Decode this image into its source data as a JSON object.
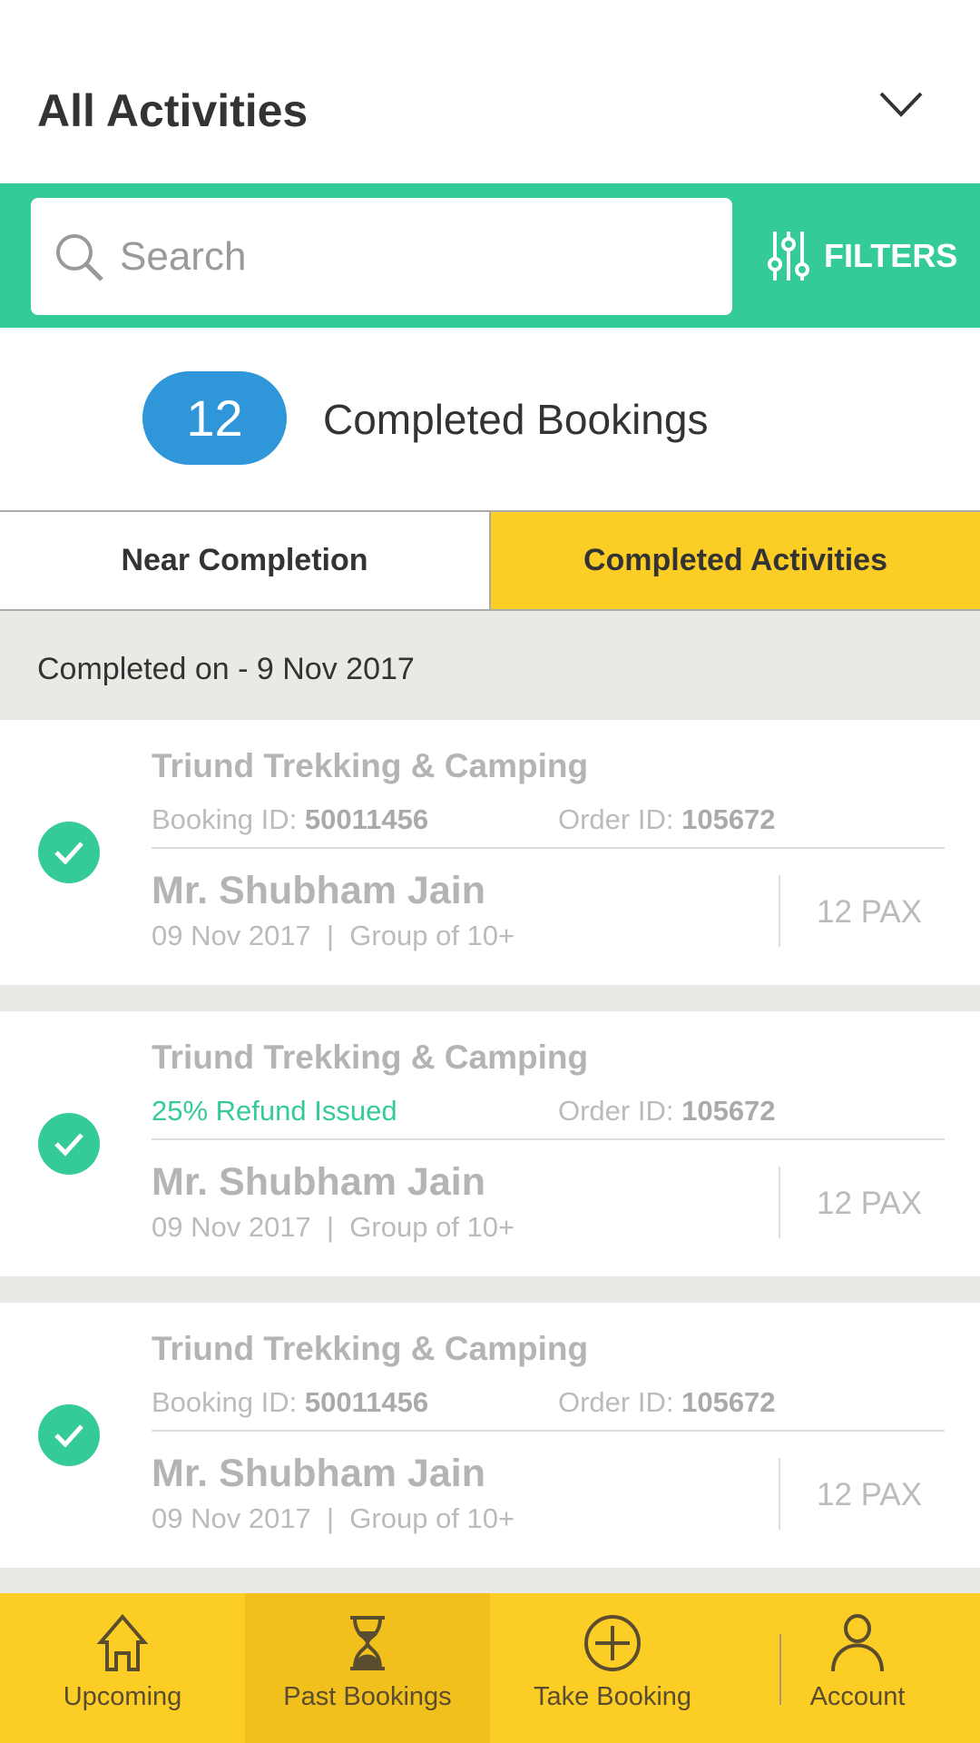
{
  "header": {
    "title": "All Activities",
    "dropdown_icon": "chevron-down-icon"
  },
  "search": {
    "placeholder": "Search",
    "value": "",
    "filters_label": "FILTERS"
  },
  "summary": {
    "count": "12",
    "label": "Completed Bookings"
  },
  "tabs": [
    {
      "label": "Near Completion",
      "active": false
    },
    {
      "label": "Completed Activities",
      "active": true
    }
  ],
  "section": {
    "label": "Completed on - 9 Nov 2017"
  },
  "cards": [
    {
      "title": "Triund Trekking & Camping",
      "booking_label": "Booking ID: ",
      "booking_id": "50011456",
      "order_label": "Order ID: ",
      "order_id": "105672",
      "name": "Mr. Shubham Jain",
      "date": "09 Nov 2017  |  Group of 10+",
      "pax": "12 PAX"
    },
    {
      "title": "Triund Trekking & Camping",
      "refund": "25% Refund Issued",
      "order_label": "Order ID: ",
      "order_id": "105672",
      "name": "Mr. Shubham Jain",
      "date": "09 Nov 2017  |  Group of 10+",
      "pax": "12 PAX"
    },
    {
      "title": "Triund Trekking & Camping",
      "booking_label": "Booking ID: ",
      "booking_id": "50011456",
      "order_label": "Order ID: ",
      "order_id": "105672",
      "name": "Mr. Shubham Jain",
      "date": "09 Nov 2017  |  Group of 10+",
      "pax": "12 PAX"
    }
  ],
  "nav": [
    {
      "label": "Upcoming",
      "icon": "home-icon"
    },
    {
      "label": "Past Bookings",
      "icon": "hourglass-icon",
      "active": true
    },
    {
      "label": "Take Booking",
      "icon": "plus-circle-icon"
    },
    {
      "label": "Account",
      "icon": "user-icon"
    }
  ],
  "colors": {
    "green": "#35cb98",
    "yellow": "#fccd25",
    "blue": "#2f96d9"
  }
}
